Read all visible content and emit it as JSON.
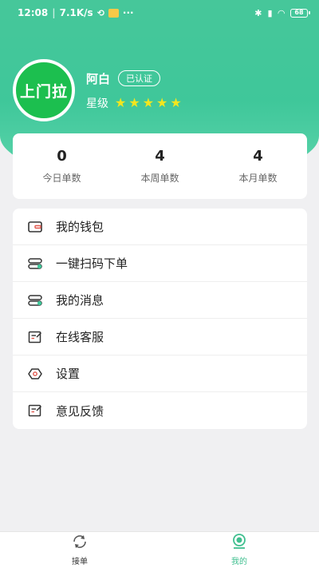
{
  "status_bar": {
    "time": "12:08",
    "speed": "7.1K/s",
    "more": "···",
    "battery": "68"
  },
  "profile": {
    "logo_text": "上门拉",
    "name": "阿白",
    "verified_badge": "已认证",
    "rating_label": "星级",
    "rating_stars": 5
  },
  "stats": [
    {
      "value": "0",
      "label": "今日单数"
    },
    {
      "value": "4",
      "label": "本周单数"
    },
    {
      "value": "4",
      "label": "本月单数"
    }
  ],
  "menu": [
    {
      "label": "我的钱包",
      "icon": "wallet-icon"
    },
    {
      "label": "一键扫码下单",
      "icon": "toggle-icon"
    },
    {
      "label": "我的消息",
      "icon": "toggle-icon"
    },
    {
      "label": "在线客服",
      "icon": "edit-note-icon"
    },
    {
      "label": "设置",
      "icon": "settings-hex-icon"
    },
    {
      "label": "意见反馈",
      "icon": "edit-note-icon"
    }
  ],
  "tabbar": {
    "orders_label": "接单",
    "mine_label": "我的"
  },
  "colors": {
    "brand_green": "#3fc79a",
    "logo_green": "#1cbf4f",
    "star_yellow": "#f3e61e",
    "accent_red": "#e2574c"
  }
}
